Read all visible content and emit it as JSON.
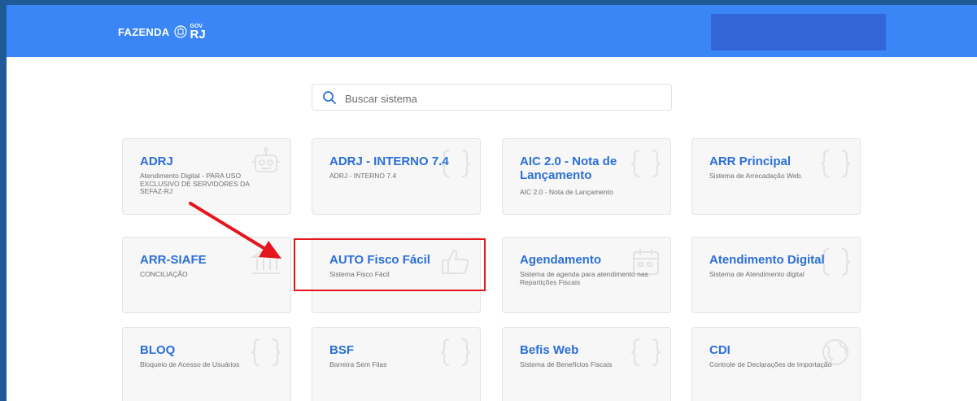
{
  "header": {
    "brand_name": "FAZENDA",
    "brand_gov_top": "GOV",
    "brand_gov_bottom": "RJ"
  },
  "search": {
    "placeholder": "Buscar sistema"
  },
  "systems": [
    {
      "title": "ADRJ",
      "description": "Atendimento Digital - PARA USO EXCLUSIVO DE SERVIDORES DA SEFAZ-RJ",
      "icon": "robot-icon"
    },
    {
      "title": "ADRJ - INTERNO 7.4",
      "description": "ADRJ - INTERNO 7.4",
      "icon": "braces-icon"
    },
    {
      "title": "AIC 2.0 - Nota de Lançamento",
      "description": "AIC 2.0 - Nota de Lançamento",
      "icon": "braces-icon"
    },
    {
      "title": "ARR Principal",
      "description": "Sistema de Arrecadação Web.",
      "icon": "braces-icon"
    },
    {
      "title": "ARR-SIAFE",
      "description": "CONCILIAÇÃO",
      "icon": "bank-icon"
    },
    {
      "title": "AUTO Fisco Fácil",
      "description": "Sistema Fisco Fácil",
      "icon": "thumbs-up-icon"
    },
    {
      "title": "Agendamento",
      "description": "Sistema de agenda para atendimento nas Repartições Fiscais",
      "icon": "calendar-icon"
    },
    {
      "title": "Atendimento Digital",
      "description": "Sistema de Atendimento digital",
      "icon": "braces-icon"
    },
    {
      "title": "BLOQ",
      "description": "Bloqueio de Acesso de Usuários",
      "icon": "braces-icon"
    },
    {
      "title": "BSF",
      "description": "Barreira Sem Filas",
      "icon": "braces-icon"
    },
    {
      "title": "Befis Web",
      "description": "Sistema de Benefícios Fiscais",
      "icon": "braces-icon"
    },
    {
      "title": "CDI",
      "description": "Controle de Declarações de Importação",
      "icon": "globe-icon"
    }
  ],
  "annotation": {
    "highlighted_item": "AUTO Fisco Fácil",
    "color": "#e4161b"
  },
  "colors": {
    "header": "#3a86f7",
    "link": "#2b6fd6",
    "outer_border": "#1f5a96"
  }
}
